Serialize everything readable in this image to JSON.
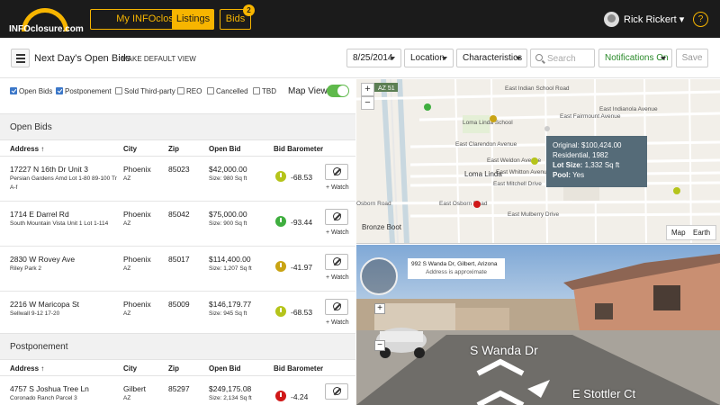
{
  "brand": {
    "logo_text": "INFOclosure.com",
    "accent": "#f7b500"
  },
  "nav": {
    "my_info": "My INFOclosure",
    "listings": "Listings",
    "bids": "Bids",
    "bids_badge": "2",
    "user_name": "Rick Rickert ▾",
    "help": "?"
  },
  "toolbar": {
    "title": "Next Day's Open Bids",
    "make_default": "MAKE DEFAULT VIEW",
    "date": "8/25/2014",
    "location": "Location",
    "characteristics": "Characteristics",
    "search_placeholder": "Search",
    "notifications": "Notifications On",
    "save": "Save"
  },
  "filters": {
    "items": [
      {
        "label": "Open Bids",
        "checked": true
      },
      {
        "label": "Postponement",
        "checked": true
      },
      {
        "label": "Sold Third-party",
        "checked": false
      },
      {
        "label": "REO",
        "checked": false
      },
      {
        "label": "Cancelled",
        "checked": false
      },
      {
        "label": "TBD",
        "checked": false
      }
    ],
    "map_view": "Map View"
  },
  "columns": {
    "address": "Address ↑",
    "city": "City",
    "zip": "Zip",
    "open_bid": "Open Bid",
    "barometer": "Bid Barometer"
  },
  "open_bids": {
    "title": "Open Bids",
    "rows": [
      {
        "address": "17227 N 16th Dr Unit 3",
        "legal": "Persian Gardens Amd Lot 1-80 89-100 Tr A-f",
        "city": "Phoenix",
        "state": "AZ",
        "zip": "85023",
        "bid": "$42,000.00",
        "size": "Size: 980 Sq ft",
        "barometer": "-68.53",
        "color": "#b5c41b",
        "watch": "+ Watch"
      },
      {
        "address": "1714 E Darrel Rd",
        "legal": "South Mountain Vista Unit 1 Lot 1-114",
        "city": "Phoenix",
        "state": "AZ",
        "zip": "85042",
        "bid": "$75,000.00",
        "size": "Size: 900 Sq ft",
        "barometer": "-93.44",
        "color": "#3fae3f",
        "watch": "+ Watch"
      },
      {
        "address": "2830 W Rovey Ave",
        "legal": "Riley Park 2",
        "city": "Phoenix",
        "state": "AZ",
        "zip": "85017",
        "bid": "$114,400.00",
        "size": "Size: 1,207 Sq ft",
        "barometer": "-41.97",
        "color": "#c9a414",
        "watch": "+ Watch"
      },
      {
        "address": "2216 W Maricopa St",
        "legal": "Sellwall 9-12 17-20",
        "city": "Phoenix",
        "state": "AZ",
        "zip": "85009",
        "bid": "$146,179.77",
        "size": "Size: 945 Sq ft",
        "barometer": "-68.53",
        "color": "#b5c41b",
        "watch": "+ Watch"
      }
    ]
  },
  "postponement": {
    "title": "Postponement",
    "rows": [
      {
        "address": "4757 S Joshua Tree Ln",
        "legal": "Coronado Ranch Parcel 3",
        "city": "Gilbert",
        "state": "AZ",
        "zip": "85297",
        "bid": "$249,175.08",
        "size": "Size: 2,134 Sq ft",
        "barometer": "-4.24",
        "color": "#d01818",
        "watch": ""
      }
    ]
  },
  "map": {
    "zoom_in": "+",
    "zoom_out": "−",
    "labels": [
      {
        "text": "East Indian School Road"
      },
      {
        "text": "Loma Linda School"
      },
      {
        "text": "East Fairmount Avenue"
      },
      {
        "text": "East Clarendon Avenue"
      },
      {
        "text": "East Whitton Avenue"
      },
      {
        "text": "Loma Linda"
      },
      {
        "text": "East Mitchell Drive"
      },
      {
        "text": "Osborn Road"
      },
      {
        "text": "East Osborn Road"
      },
      {
        "text": "East Mulberry Drive"
      },
      {
        "text": "Bronze Boot"
      },
      {
        "text": "East Weldon Avenue"
      },
      {
        "text": "East Indianola Avenue"
      }
    ],
    "highway_label": "AZ 51",
    "info": {
      "original": "Original: $100,424.00",
      "residential": "Residential, 1982",
      "lot_label": "Lot Size:",
      "lot_value": "1,332 Sq ft",
      "pool_label": "Pool:",
      "pool_value": "Yes"
    },
    "tab_map": "Map",
    "tab_earth": "Earth"
  },
  "street_view": {
    "address": "992 S Wanda Dr, Gilbert, Arizona",
    "approx": "Address is approximate",
    "road1": "S Wanda Dr",
    "road2": "E Stottler Ct",
    "zoom_in": "+",
    "zoom_out": "−"
  }
}
